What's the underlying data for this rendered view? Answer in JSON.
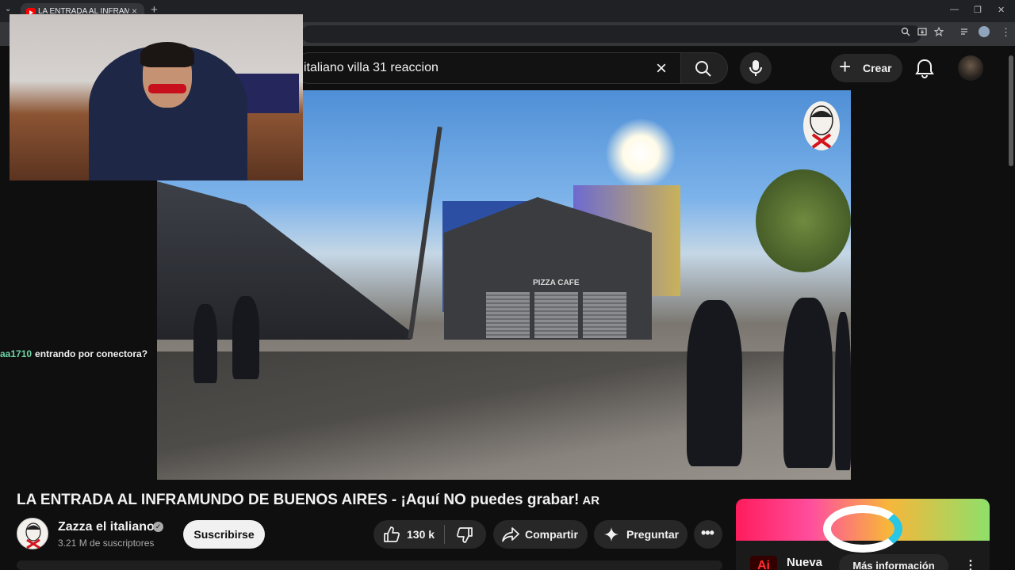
{
  "browser": {
    "tab_title": "LA ENTRADA AL INFRAMUNDO DE BUENOS AIRES - ¡Aquí NO puedes grabar!",
    "tab_close": "×",
    "new_tab": "+",
    "tab_search": "⌄",
    "window_minimize": "—",
    "window_restore": "❐",
    "window_close": "✕"
  },
  "youtube_header": {
    "search_query": "italiano villa 31 reaccion",
    "clear_glyph": "×",
    "create_label": "Crear",
    "create_glyph": "+"
  },
  "chat": {
    "user": "aa1710",
    "message": "entrando por conectora?"
  },
  "video": {
    "sign_text": "PIZZA CAFE",
    "title": "LA ENTRADA AL INFRAMUNDO DE BUENOS AIRES - ¡Aquí NO puedes grabar!",
    "title_badge": "AR"
  },
  "channel": {
    "name": "Zazza el italiano",
    "verified_glyph": "✓",
    "subscribers": "3.21 M de suscriptores",
    "subscribe_label": "Suscribirse"
  },
  "actions": {
    "like_count": "130 k",
    "share_label": "Compartir",
    "ask_label": "Preguntar",
    "more_glyph": "•••"
  },
  "ad": {
    "logo_text": "Ai",
    "text": "Nueva",
    "cta_label": "Más información",
    "more_glyph": "⋮"
  },
  "colors": {
    "background": "#0f0f0f",
    "chat_user": "#6fd3a4",
    "subscribe_bg": "#f1f1f1",
    "pill_bg": "#272727"
  }
}
